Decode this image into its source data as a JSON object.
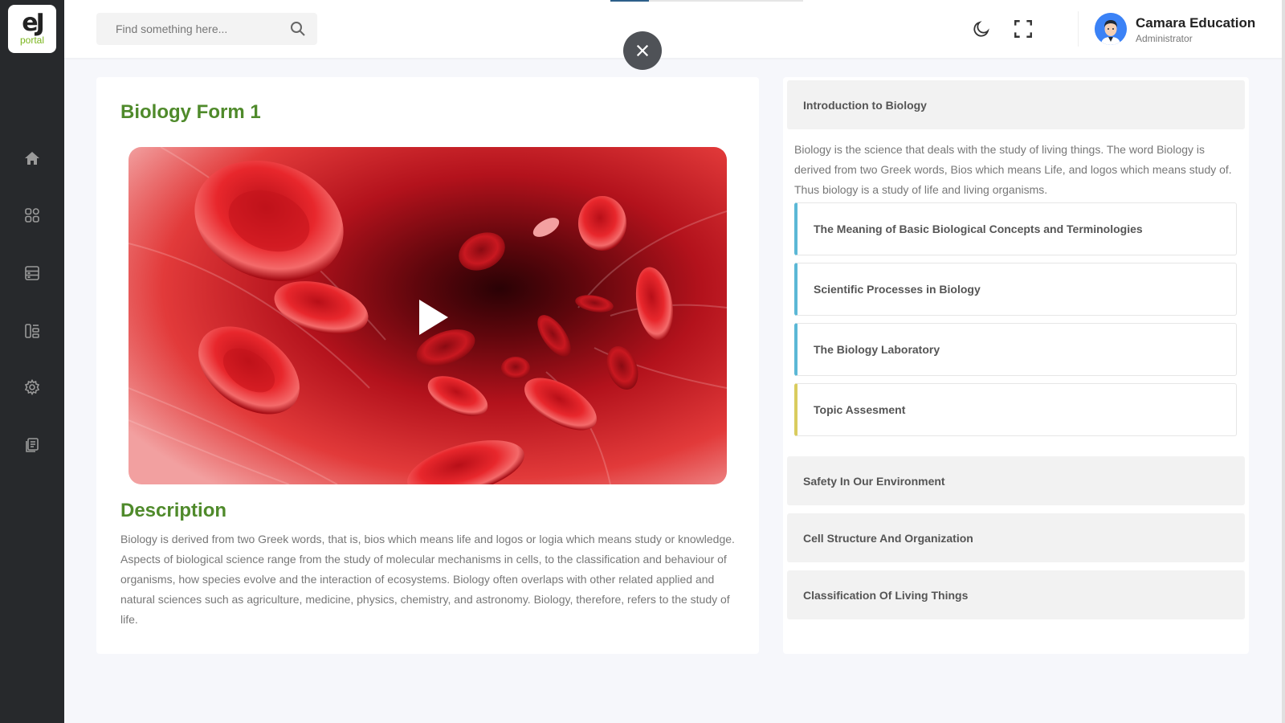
{
  "app": {
    "logo_mark": "eJ",
    "logo_sub": "portal"
  },
  "sidebar": {
    "items": [
      {
        "icon": "home-icon"
      },
      {
        "icon": "grid-icon"
      },
      {
        "icon": "list-icon"
      },
      {
        "icon": "layout-icon"
      },
      {
        "icon": "gear-icon"
      },
      {
        "icon": "document-icon"
      }
    ]
  },
  "header": {
    "search_placeholder": "Find something here...",
    "user_name": "Camara Education",
    "user_role": "Administrator",
    "progress_fraction": 0.2
  },
  "main": {
    "title": "Biology Form 1",
    "description_heading": "Description",
    "description": "Biology is derived from two Greek words, that is, bios which means life and logos or logia which means study or knowledge. Aspects of biological science range from the study of molecular mechanisms in cells, to the classification and behaviour of organisms, how species evolve and the interaction of ecosystems. Biology often overlaps with other related applied and natural sciences such as agriculture, medicine, physics, chemistry, and astronomy. Biology, therefore, refers to the study of life."
  },
  "topics": {
    "intro_title": "Introduction to Biology",
    "intro_text": "Biology is the science that deals with the study of living things. The word Biology is derived from two Greek words, Bios which means Life, and logos which means study of. Thus biology is a study of life and living organisms.",
    "subtopics": [
      "The Meaning of Basic Biological Concepts and Terminologies",
      "Scientific Processes in Biology",
      "The Biology Laboratory",
      "Topic Assesment"
    ],
    "other_topics": [
      "Safety In Our Environment",
      "Cell Structure And Organization",
      "Classification Of Living Things"
    ]
  },
  "colors": {
    "accent_green": "#4f8a2b",
    "subtopic_border": "#5bb8d6",
    "assessment_border": "#d9cc5e",
    "sidebar_bg": "#27292c"
  }
}
